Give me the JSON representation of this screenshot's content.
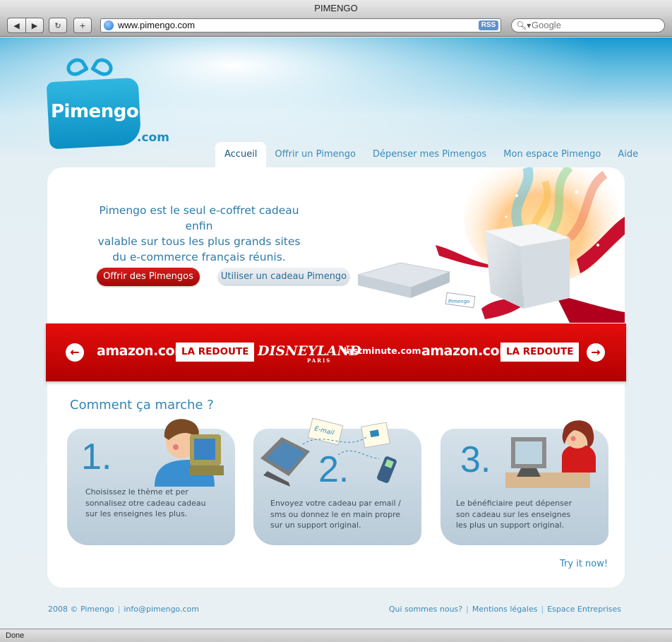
{
  "window": {
    "title": "PIMENGO"
  },
  "toolbar": {
    "url": "www.pimengo.com",
    "rss_label": "RSS",
    "search_placeholder": "Google"
  },
  "site": {
    "logo_text": "Pimengo",
    "logo_suffix": ".com",
    "tabs": [
      {
        "label": "Accueil",
        "active": true
      },
      {
        "label": "Offrir un Pimengo"
      },
      {
        "label": "Dépenser mes Pimengos"
      },
      {
        "label": "Mon espace Pimengo"
      },
      {
        "label": "Aide"
      }
    ],
    "hero": {
      "line1": "Pimengo est le seul e-coffret cadeau enfin",
      "line2": "valable sur tous les plus grands sites",
      "line3": "du e-commerce français réunis.",
      "btn_offer": "Offrir des Pimengos",
      "btn_use": "Utiliser un cadeau Pimengo",
      "tag_label": "Pimengo"
    },
    "brands": [
      "amazon.com",
      "LA REDOUTE",
      "DISNEYLAND",
      "PARIS",
      "lastminute.com",
      "amazon.com",
      "LA REDOUTE"
    ],
    "how_title": "Comment ça marche ?",
    "steps": [
      {
        "num": "1.",
        "text": "Choisissez le thème et per sonnalisez otre cadeau cadeau sur les enseignes les plus."
      },
      {
        "num": "2.",
        "text": "Envoyez votre cadeau par email / sms ou donnez le en main propre sur un support original."
      },
      {
        "num": "3.",
        "text": "Le bénéficiaire peut dépenser son cadeau sur les enseignes les plus un support original."
      }
    ],
    "email_card_label": "E-mail",
    "try_label": "Try it now!",
    "footer": {
      "copyright": "2008 © Pimengo",
      "email": "info@pimengo.com",
      "links": [
        "Qui sommes nous?",
        "Mentions légales",
        "Espace Entreprises"
      ]
    }
  },
  "status": {
    "text": "Done"
  },
  "colors": {
    "accent_blue": "#2d86b8",
    "brand_red": "#c00000",
    "logo_blue": "#1aa4d8"
  }
}
